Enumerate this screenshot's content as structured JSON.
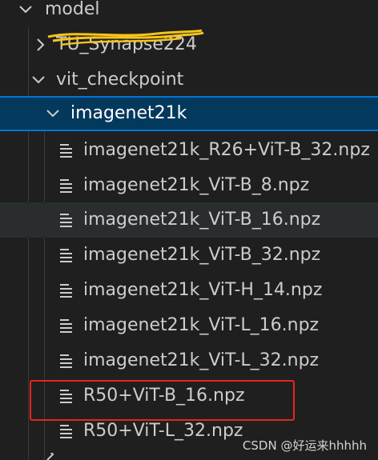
{
  "tree": {
    "root": {
      "label": "model",
      "expanded": true
    },
    "folder_obscured": {
      "label": "TU_Synapse224",
      "expanded": false
    },
    "folder_vit": {
      "label": "vit_checkpoint",
      "expanded": true
    },
    "folder_imagenet": {
      "label": "imagenet21k",
      "expanded": true,
      "selected": true
    },
    "files": [
      {
        "label": "imagenet21k_R26+ViT-B_32.npz"
      },
      {
        "label": "imagenet21k_ViT-B_8.npz"
      },
      {
        "label": "imagenet21k_ViT-B_16.npz",
        "hovered": true
      },
      {
        "label": "imagenet21k_ViT-B_32.npz"
      },
      {
        "label": "imagenet21k_ViT-H_14.npz"
      },
      {
        "label": "imagenet21k_ViT-L_16.npz"
      },
      {
        "label": "imagenet21k_ViT-L_32.npz"
      },
      {
        "label": "R50+ViT-B_16.npz",
        "annotated": true
      },
      {
        "label": "R50+ViT-L_32.npz"
      }
    ]
  },
  "icons": {
    "chevron_down": "chevron-down-icon",
    "chevron_right": "chevron-right-icon",
    "file": "file-lines-icon"
  },
  "colors": {
    "background": "#1f1f1f",
    "text": "#cccccc",
    "selection": "#04395e",
    "selection_border": "#0078d4",
    "hover": "#2a2d2e",
    "annotation_box": "#e8251f",
    "scribble": "#f5c518"
  },
  "watermark": "CSDN @好运来hhhhh"
}
